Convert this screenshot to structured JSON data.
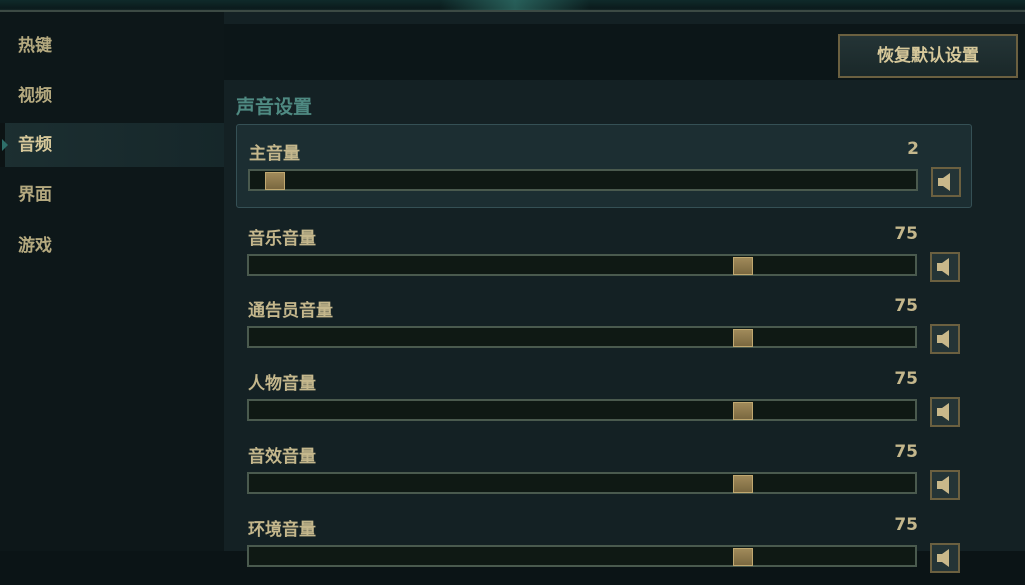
{
  "sidebar": {
    "items": [
      {
        "label": "热键",
        "active": false
      },
      {
        "label": "视频",
        "active": false
      },
      {
        "label": "音频",
        "active": true
      },
      {
        "label": "界面",
        "active": false
      },
      {
        "label": "游戏",
        "active": false
      }
    ]
  },
  "toolbar": {
    "reset_label": "恢复默认设置"
  },
  "audio": {
    "section_title": "声音设置",
    "sliders": [
      {
        "label": "主音量",
        "value": "2",
        "level": 2,
        "highlighted": true
      },
      {
        "label": "音乐音量",
        "value": "75",
        "level": 75,
        "highlighted": false
      },
      {
        "label": "通告员音量",
        "value": "75",
        "level": 75,
        "highlighted": false
      },
      {
        "label": "人物音量",
        "value": "75",
        "level": 75,
        "highlighted": false
      },
      {
        "label": "音效音量",
        "value": "75",
        "level": 75,
        "highlighted": false
      },
      {
        "label": "环境音量",
        "value": "75",
        "level": 75,
        "highlighted": false
      }
    ]
  },
  "icons": {
    "mute": "speaker-icon",
    "active_marker": "triangle-marker-icon"
  },
  "colors": {
    "accent_teal": "#4f8a82",
    "gold_text": "#c4b78c",
    "gold_border": "#6b6040"
  }
}
